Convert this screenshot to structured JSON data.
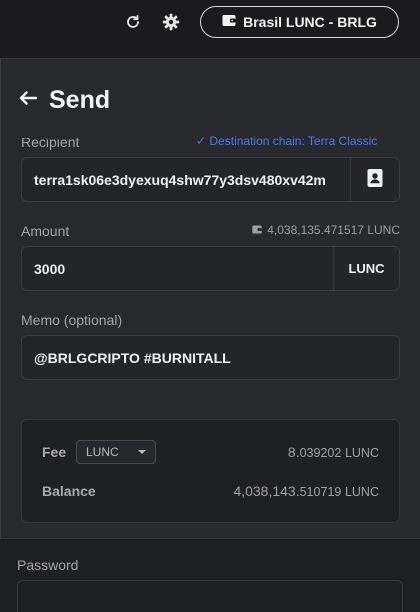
{
  "header": {
    "wallet_label": "Brasil LUNC - BRLG",
    "icons": [
      "refresh-icon",
      "gear-icon",
      "wallet-icon"
    ]
  },
  "page": {
    "title": "Send",
    "back_icon": "arrow-left-icon"
  },
  "recipient": {
    "label": "Recipient",
    "chain_hint": "✓ Destination chain: Terra Classic",
    "value": "terra1sk06e3dyexuq4shw77y3dsv480xv42m",
    "addon_icon": "address-book-icon"
  },
  "amount": {
    "label": "Amount",
    "available": "4,038,135.471517 LUNC",
    "value": "3000",
    "denom": "LUNC"
  },
  "memo": {
    "label": "Memo (optional)",
    "value": "@BRLGCRIPTO #BURNITALL"
  },
  "fee": {
    "label": "Fee",
    "denom_selected": "LUNC",
    "amount_main": "8.",
    "amount_decimals": "039202",
    "amount_denom": "LUNC"
  },
  "balance": {
    "label": "Balance",
    "amount_main": "4,038,143.",
    "amount_decimals": "510719",
    "amount_denom": "LUNC"
  },
  "password": {
    "label": "Password"
  },
  "colors": {
    "accent_blue": "#4b76f5",
    "panel": "#28292c",
    "background": "#1b1b1d"
  }
}
